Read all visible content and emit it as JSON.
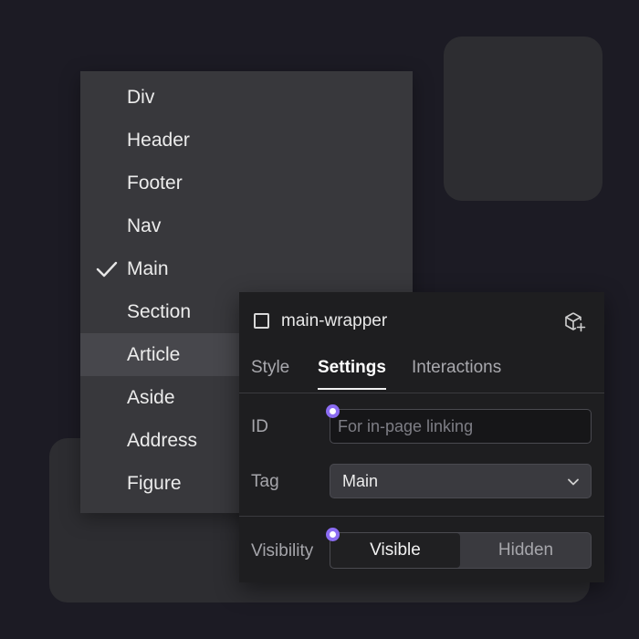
{
  "dropdown": {
    "items": [
      {
        "label": "Div"
      },
      {
        "label": "Header"
      },
      {
        "label": "Footer"
      },
      {
        "label": "Nav"
      },
      {
        "label": "Main",
        "checked": true
      },
      {
        "label": "Section"
      },
      {
        "label": "Article",
        "hovered": true
      },
      {
        "label": "Aside"
      },
      {
        "label": "Address"
      },
      {
        "label": "Figure"
      }
    ]
  },
  "panel": {
    "element_name": "main-wrapper",
    "header_icon": "cube-plus-icon",
    "tabs": [
      {
        "label": "Style",
        "active": false
      },
      {
        "label": "Settings",
        "active": true
      },
      {
        "label": "Interactions",
        "active": false
      }
    ],
    "id_field": {
      "label": "ID",
      "value": "",
      "placeholder": "For in-page linking"
    },
    "tag_field": {
      "label": "Tag",
      "value": "Main"
    },
    "visibility": {
      "label": "Visibility",
      "options": [
        "Visible",
        "Hidden"
      ],
      "selected": "Visible"
    }
  },
  "colors": {
    "background": "#1c1b24",
    "menu": "#38383c",
    "panel": "#1e1e20",
    "accent_dot": "#8b6cf2"
  }
}
